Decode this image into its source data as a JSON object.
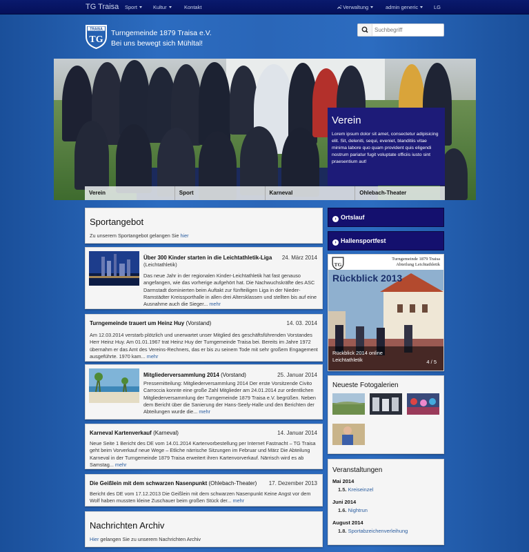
{
  "navbar": {
    "brand": "TG Traisa",
    "sport": "Sport",
    "kultur": "Kultur",
    "kontakt": "Kontakt",
    "verwaltung": "Verwaltung",
    "admin": "admin generic",
    "lg": "LG"
  },
  "header": {
    "title": "Turngemeinde 1879 Traisa e.V.",
    "slogan": "Bei uns bewegt sich Mühltal!",
    "logo_text": "TRAISA"
  },
  "search": {
    "placeholder": "Suchbegriff"
  },
  "hero": {
    "heading": "Verein",
    "text": "Lorem ipsum dolor sit amet, consectetur adipisicing elit. Sit, deleniti, sequi, eveniet, blanditiis vitae minima labore quo quam provident quis eligendi nostrum pariatur fugit voluptate officiis iusto sint praesentium aut!",
    "tabs": [
      "Verein",
      "Sport",
      "Karneval",
      "Ohlebach-Theater"
    ]
  },
  "sportangebot": {
    "title": "Sportangebot",
    "text": "Zu unserem Sportangebot gelangen Sie",
    "link": "hier"
  },
  "news": [
    {
      "title": "Über 300 Kinder starten in die Leichtathletik-Liga",
      "category": "(Leichtathletik)",
      "date": "24. März 2014",
      "text": "Das neue Jahr in der regionalen Kinder-Leichtathletik hat fast genauso angefangen, wie das vorherige aufgehört hat. Die Nachwuchskräfte des ASC Darmstadt dominierten beim Auftakt zur fünfteiligen Liga in der Nieder-Ramstädter Kreissporthalle in allen drei Altersklassen und stellten bis auf eine Ausnahme auch die Sieger...",
      "more": "mehr"
    },
    {
      "title": "Turngemeinde trauert um Heinz Huy",
      "category": "(Vorstand)",
      "date": "14. 03. 2014",
      "text": "Am 12.03.2014 verstarb plötzlich und unerwartet unser Mitglied des geschäftsführenden Vorstandes Herr Heinz Huy.  Am 01.01.1967 trat Heinz Huy der Turngemeinde Traisa bei. Bereits im Jahre 1972 übernahm er das Amt des Vereins-Rechners, das er bis zu seinem Tode mit sehr großem Engagement ausgeführte. 1970 kam...",
      "more": "mehr"
    },
    {
      "title": "Mitgliederversammlung 2014",
      "category": "(Vorstand)",
      "date": "25. Januar 2014",
      "text": "Pressemitteilung: Mitgliederversammlung 2014 Der erste Vorsitzende Civito Carroccia konnte eine große Zahl Mitglieder am 24.01.2014 zur ordentlichen Mitgliederversammlung der Turngemeinde 1879 Traisa e.V. begrüßen. Neben dem Bericht über die Sanierung der Hans-Seely-Halle und den Berichten der Abteilungen wurde die...",
      "more": "mehr"
    },
    {
      "title": "Karneval Kartenverkauf",
      "category": "(Karneval)",
      "date": "14. Januar 2014",
      "text": "Neue Seite 1 Bericht des DE vom 14.01.2014 Kartenvorbestellung per Internet Fastnacht – TG Traisa geht beim Vorverkauf neue Wege – Etliche närrische Sitzungen im Februar und März Die Abteilung Karneval in der Turngemeinde 1879 Traisa erweitert ihren Kartenvorverkauf. Närrisch wird es ab Samstag...",
      "more": "mehr"
    },
    {
      "title": "Die Geißlein mit dem schwarzen Nasenpunkt",
      "category": "(Ohlebach-Theater)",
      "date": "17. Dezember 2013",
      "text": "Bericht des DE vom 17.12.2013 Die Geißlein mit dem schwarzen Nasenpunkt   Keine Angst vor dem Wolf haben mussten kleine Zuschauer beim großen Stück der...",
      "more": "mehr"
    }
  ],
  "archiv": {
    "title": "Nachrichten Archiv",
    "link": "Hier",
    "text": "gelangen Sie zu unserem Nachrichten Archiv"
  },
  "sidebar": {
    "ortslauf": "Ortslauf",
    "hallensportfest": "Hallensportfest",
    "slider": {
      "org_line1": "Turngemeinde 1879 Traisa",
      "org_line2": "Abteilung Leichtathletik",
      "headline": "Rückblick 2013",
      "caption": "Rückblick 2014 online Leichtathletik",
      "counter": "4 / 5"
    },
    "gallery_title": "Neueste Fotogalerien",
    "events_title": "Veranstaltungen",
    "events": [
      {
        "month": "Mai 2014",
        "day": "1.5.",
        "name": "Kreiseinzel"
      },
      {
        "month": "Juni 2014",
        "day": "1.6.",
        "name": "Nightrun"
      },
      {
        "month": "August 2014",
        "day": "1.8.",
        "name": "Sportabzeichenverleihung"
      }
    ]
  }
}
